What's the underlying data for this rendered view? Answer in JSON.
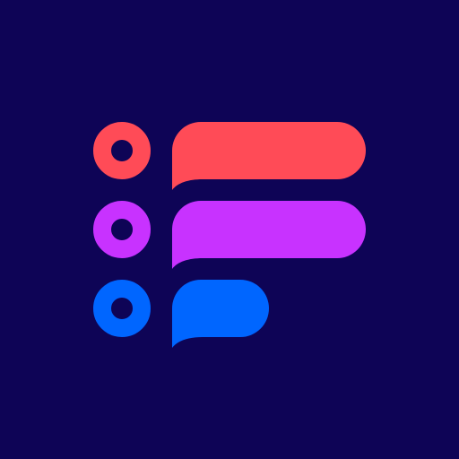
{
  "icon": {
    "colors": {
      "background": "#0E0456",
      "red": "#FF4B57",
      "purple": "#C832FF",
      "blue": "#0066FF"
    },
    "rows": [
      {
        "id": "row-1",
        "color": "#FF4B57"
      },
      {
        "id": "row-2",
        "color": "#C832FF"
      },
      {
        "id": "row-3",
        "color": "#0066FF"
      }
    ]
  }
}
